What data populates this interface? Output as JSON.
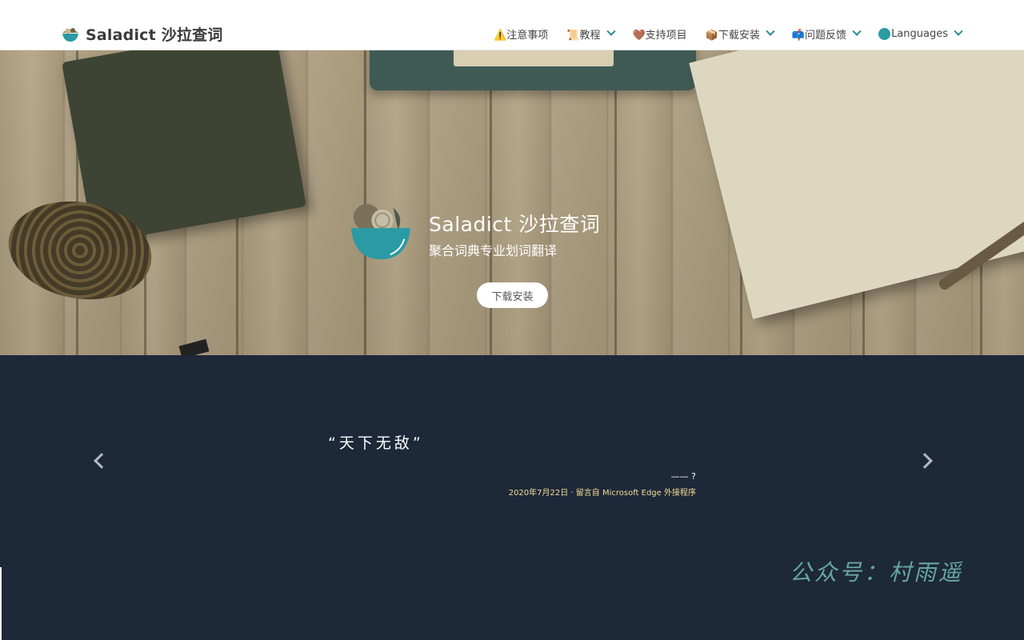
{
  "navbar": {
    "brand": "Saladict 沙拉查词",
    "items": [
      {
        "label": "⚠️注意事项",
        "dropdown": false
      },
      {
        "label": "📜教程",
        "dropdown": true
      },
      {
        "label": "🤎支持项目",
        "dropdown": false
      },
      {
        "label": "📦下载安装",
        "dropdown": true
      },
      {
        "label": "📫问题反馈",
        "dropdown": true
      },
      {
        "label": "Languages",
        "dropdown": true,
        "icon": "globe-icon"
      }
    ]
  },
  "hero": {
    "title": "Saladict 沙拉查词",
    "subtitle": "聚合词典专业划词翻译",
    "button": "下载安装"
  },
  "testimonial": {
    "quote": "“天下无敌”",
    "author": "—— ?",
    "meta": "2020年7月22日 · 留言自 Microsoft Edge 外接程序"
  },
  "watermark": "公众号：村雨遥",
  "colors": {
    "nav_bg": "#ffffff",
    "accent": "#2c8c92",
    "testimonial_bg": "#1d2839",
    "meta_text": "#f3dd94"
  }
}
